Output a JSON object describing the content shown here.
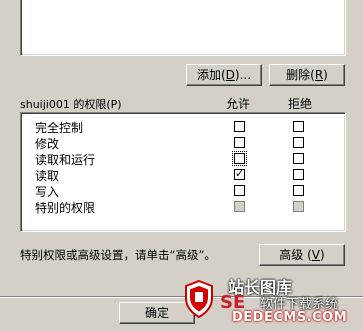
{
  "buttons": {
    "add": {
      "label": "添加",
      "hotkey": "D",
      "suffix": "..."
    },
    "remove": {
      "label": "删除",
      "hotkey": "R"
    },
    "advanced": {
      "label": "高级",
      "hotkey": "V"
    },
    "ok": {
      "label": "确定"
    }
  },
  "permissions": {
    "header": "shuiji001 的权限(P)",
    "allow_header": "允许",
    "deny_header": "拒绝",
    "rows": [
      {
        "label": "完全控制",
        "allow": false,
        "deny": false,
        "disabled": false
      },
      {
        "label": "修改",
        "allow": false,
        "deny": false,
        "disabled": false
      },
      {
        "label": "读取和运行",
        "allow": false,
        "deny": false,
        "disabled": false,
        "focus": true
      },
      {
        "label": "读取",
        "allow": true,
        "deny": false,
        "disabled": false
      },
      {
        "label": "写入",
        "allow": false,
        "deny": false,
        "disabled": false
      },
      {
        "label": "特别的权限",
        "allow": false,
        "deny": false,
        "disabled": true
      }
    ]
  },
  "advanced_hint": "特别权限或高级设置，请单击“高级”。",
  "watermark": {
    "line1": "站长图库",
    "line2": "软件下载系统",
    "site": "DEDECMS.COM",
    "brand": "SE"
  }
}
